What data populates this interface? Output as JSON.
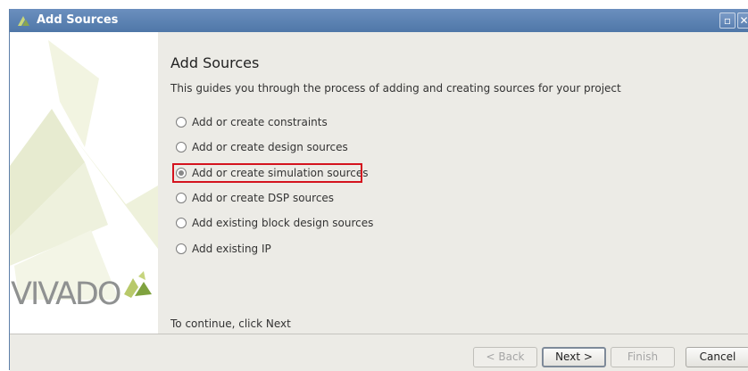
{
  "window": {
    "title": "Add Sources",
    "title_icon": "vivado-logo-icon",
    "controls": [
      "maximize-icon",
      "close-icon"
    ]
  },
  "branding": {
    "logo_text": "VIVADO",
    "accent": "#8aa64f"
  },
  "page": {
    "heading": "Add Sources",
    "description": "This guides you through the process of adding and creating sources for your project",
    "continue_hint": "To continue, click Next"
  },
  "options": [
    {
      "label": "Add or create constraints",
      "selected": false
    },
    {
      "label": "Add or create design sources",
      "selected": false
    },
    {
      "label": "Add or create simulation sources",
      "selected": true
    },
    {
      "label": "Add or create DSP sources",
      "selected": false
    },
    {
      "label": "Add existing block design sources",
      "selected": false
    },
    {
      "label": "Add existing IP",
      "selected": false
    }
  ],
  "buttons": {
    "back": "< Back",
    "next": "Next >",
    "finish": "Finish",
    "cancel": "Cancel"
  },
  "colors": {
    "titlebar": "#5a80b2",
    "highlight": "#d4131e",
    "background": "#ecebe6"
  }
}
